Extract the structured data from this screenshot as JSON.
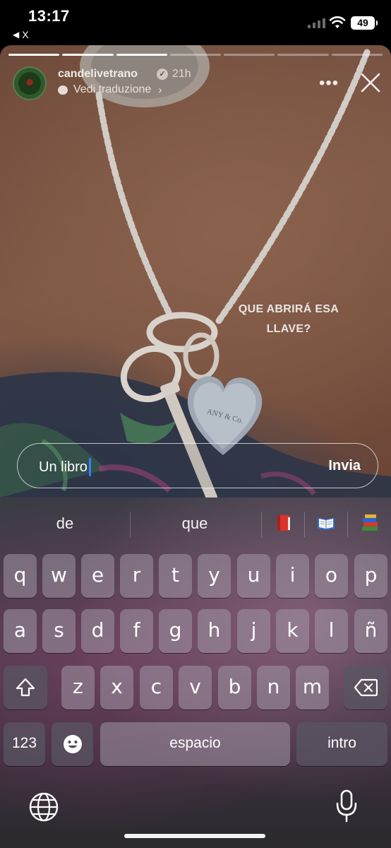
{
  "status_bar": {
    "time": "13:17",
    "back_app": "X",
    "battery": "49"
  },
  "story": {
    "progress_segments": 7,
    "progress_completed": 3,
    "username": "candelivetrano",
    "verified_icon": "verified-badge-icon",
    "time_ago": "21h",
    "translate_label": "Vedi traduzione",
    "caption": "QUE ABRIRÁ ESA LLAVE?",
    "reply": {
      "value": "Un libro",
      "send_label": "Invia"
    }
  },
  "keyboard": {
    "suggestions": [
      "de",
      "que"
    ],
    "emoji_suggestions": [
      "red-book-emoji",
      "open-book-emoji",
      "books-stack-emoji"
    ],
    "row1": [
      "q",
      "w",
      "e",
      "r",
      "t",
      "y",
      "u",
      "i",
      "o",
      "p"
    ],
    "row2": [
      "a",
      "s",
      "d",
      "f",
      "g",
      "h",
      "j",
      "k",
      "l",
      "ñ"
    ],
    "row3": [
      "z",
      "x",
      "c",
      "v",
      "b",
      "n",
      "m"
    ],
    "numbers_label": "123",
    "space_label": "espacio",
    "return_label": "intro"
  },
  "colors": {
    "caret": "#3b7cff",
    "story_background": "#7d5645"
  }
}
